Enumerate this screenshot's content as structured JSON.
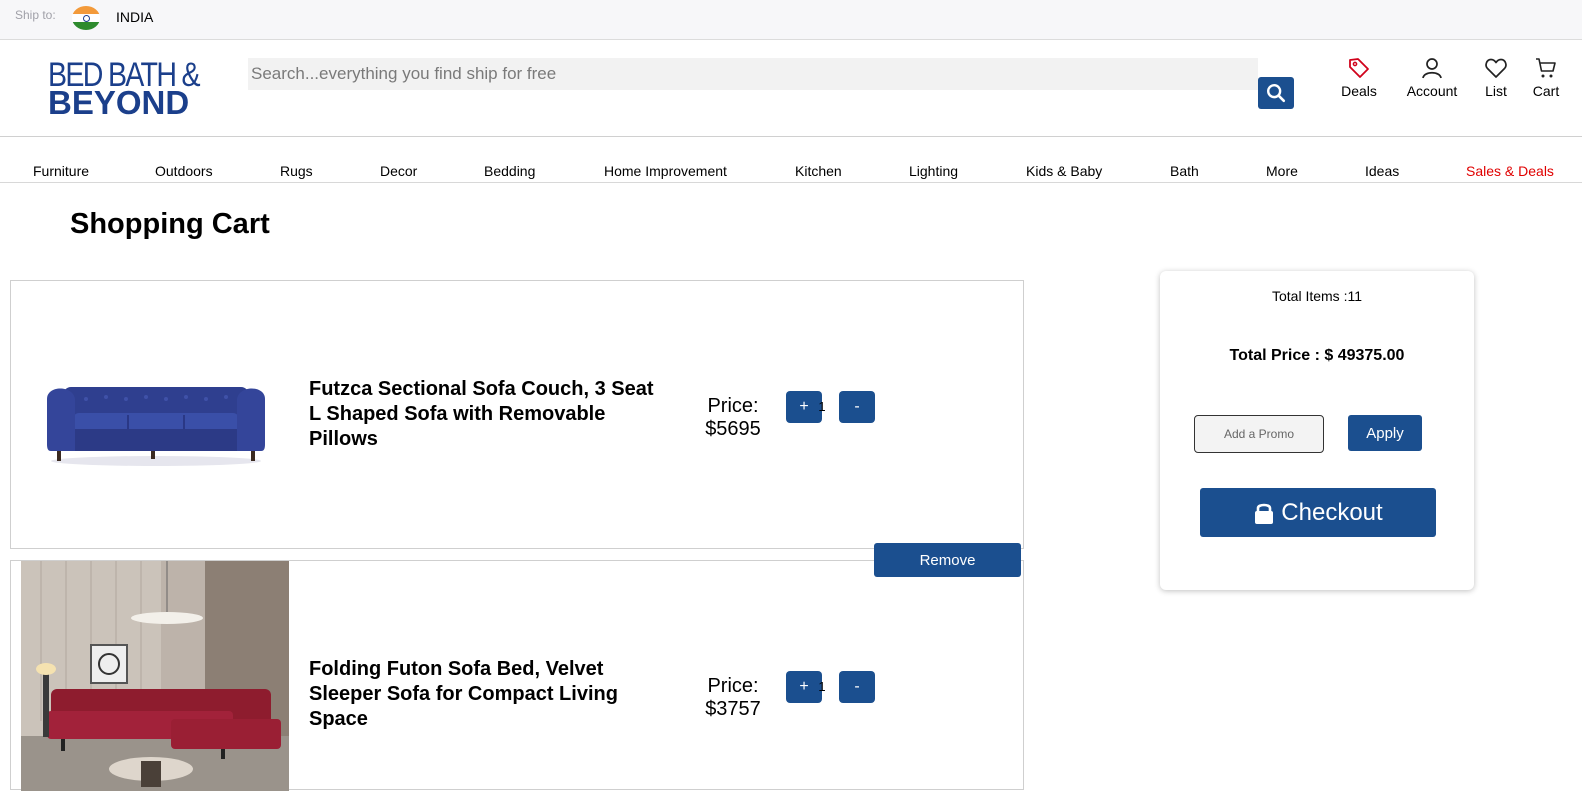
{
  "shipbar": {
    "label": "Ship to:",
    "country": "INDIA"
  },
  "header": {
    "logo_line1": "BED BATH &",
    "logo_line2": "BEYOND",
    "search_placeholder": "Search...everything you find ship for free",
    "icons": {
      "deals": "Deals",
      "account": "Account",
      "list": "List",
      "cart": "Cart"
    }
  },
  "nav": {
    "items": [
      "Furniture",
      "Outdoors",
      "Rugs",
      "Decor",
      "Bedding",
      "Home Improvement",
      "Kitchen",
      "Lighting",
      "Kids & Baby",
      "Bath",
      "More",
      "Ideas",
      "Sales & Deals"
    ],
    "highlight_color": "#e00000"
  },
  "page": {
    "title": "Shopping Cart"
  },
  "cart": {
    "items": [
      {
        "title": "Futzca Sectional Sofa Couch, 3 Seat L Shaped Sofa with Removable Pillows",
        "price_label": "Price:",
        "price": "$5695",
        "quantity": "1",
        "plus": "+",
        "minus": "-"
      },
      {
        "title": "Folding Futon Sofa Bed, Velvet Sleeper Sofa for Compact Living Space",
        "price_label": "Price:",
        "price": "$3757",
        "quantity": "1",
        "plus": "+",
        "minus": "-"
      }
    ],
    "remove_label": "Remove"
  },
  "summary": {
    "total_items": "Total Items :11",
    "total_price": "Total Price : $ 49375.00",
    "promo_placeholder": "Add a Promo",
    "apply_label": "Apply",
    "checkout_label": "Checkout"
  },
  "colors": {
    "brand_blue": "#1b4f8f",
    "logo_blue": "#1b3f8b",
    "deal_red": "#e00000"
  }
}
